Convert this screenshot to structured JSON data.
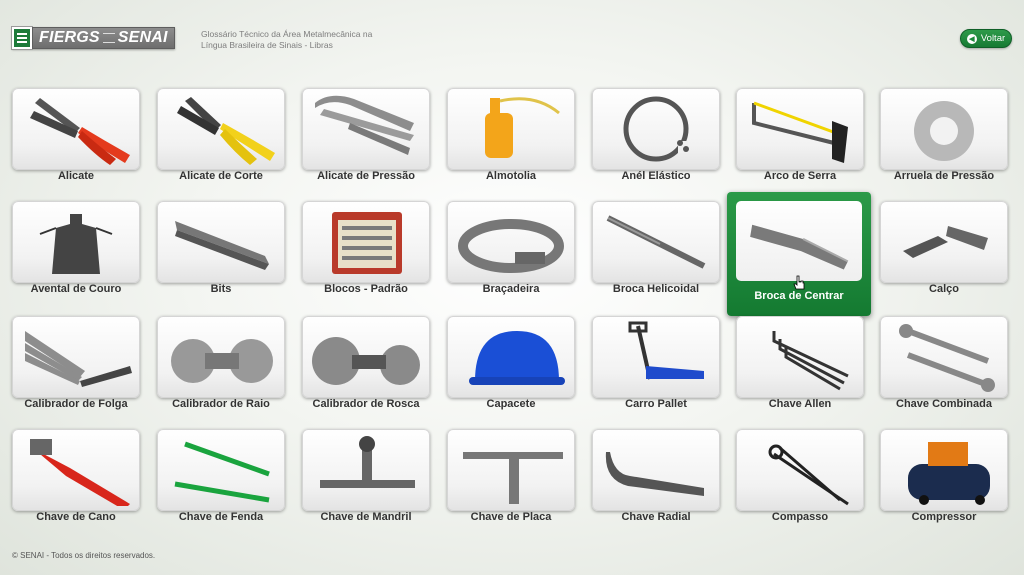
{
  "header": {
    "logo_text_left": "FIERGS",
    "logo_text_right": "SENAI",
    "title_line1": "Glossário Técnico da Área Metalmecânica na",
    "title_line2": "Língua Brasileira de Sinais - Libras",
    "back_label": "Voltar",
    "brand_color": "#1d7a3a"
  },
  "tools": [
    {
      "label": "Alicate",
      "icon": "pliers-icon"
    },
    {
      "label": "Alicate de Corte",
      "icon": "cutting-pliers-icon"
    },
    {
      "label": "Alicate de Pressão",
      "icon": "locking-pliers-icon"
    },
    {
      "label": "Almotolia",
      "icon": "oil-can-icon"
    },
    {
      "label": "Anél Elástico",
      "icon": "snap-ring-icon"
    },
    {
      "label": "Arco de Serra",
      "icon": "hacksaw-icon"
    },
    {
      "label": "Arruela de Pressão",
      "icon": "lock-washer-icon"
    },
    {
      "label": "Avental de Couro",
      "icon": "leather-apron-icon"
    },
    {
      "label": "Bits",
      "icon": "tool-bit-icon"
    },
    {
      "label": "Blocos - Padrão",
      "icon": "gauge-blocks-icon"
    },
    {
      "label": "Braçadeira",
      "icon": "hose-clamp-icon"
    },
    {
      "label": "Broca Helicoidal",
      "icon": "twist-drill-icon"
    },
    {
      "label": "Broca de Centrar",
      "icon": "center-drill-icon"
    },
    {
      "label": "Calço",
      "icon": "shim-icon"
    },
    {
      "label": "Calibrador de Folga",
      "icon": "feeler-gauge-icon"
    },
    {
      "label": "Calibrador de Raio",
      "icon": "radius-gauge-icon"
    },
    {
      "label": "Calibrador de Rosca",
      "icon": "thread-gauge-icon"
    },
    {
      "label": "Capacete",
      "icon": "helmet-icon"
    },
    {
      "label": "Carro Pallet",
      "icon": "pallet-jack-icon"
    },
    {
      "label": "Chave Allen",
      "icon": "allen-key-icon"
    },
    {
      "label": "Chave Combinada",
      "icon": "combination-wrench-icon"
    },
    {
      "label": "Chave de Cano",
      "icon": "pipe-wrench-icon"
    },
    {
      "label": "Chave de Fenda",
      "icon": "screwdriver-icon"
    },
    {
      "label": "Chave de Mandril",
      "icon": "chuck-key-icon"
    },
    {
      "label": "Chave de Placa",
      "icon": "lathe-chuck-key-icon"
    },
    {
      "label": "Chave Radial",
      "icon": "hook-spanner-icon"
    },
    {
      "label": "Compasso",
      "icon": "divider-compass-icon"
    },
    {
      "label": "Compressor",
      "icon": "air-compressor-icon"
    }
  ],
  "selected_tool": "Broca de Centrar",
  "footer": "© SENAI - Todos os direitos reservados."
}
